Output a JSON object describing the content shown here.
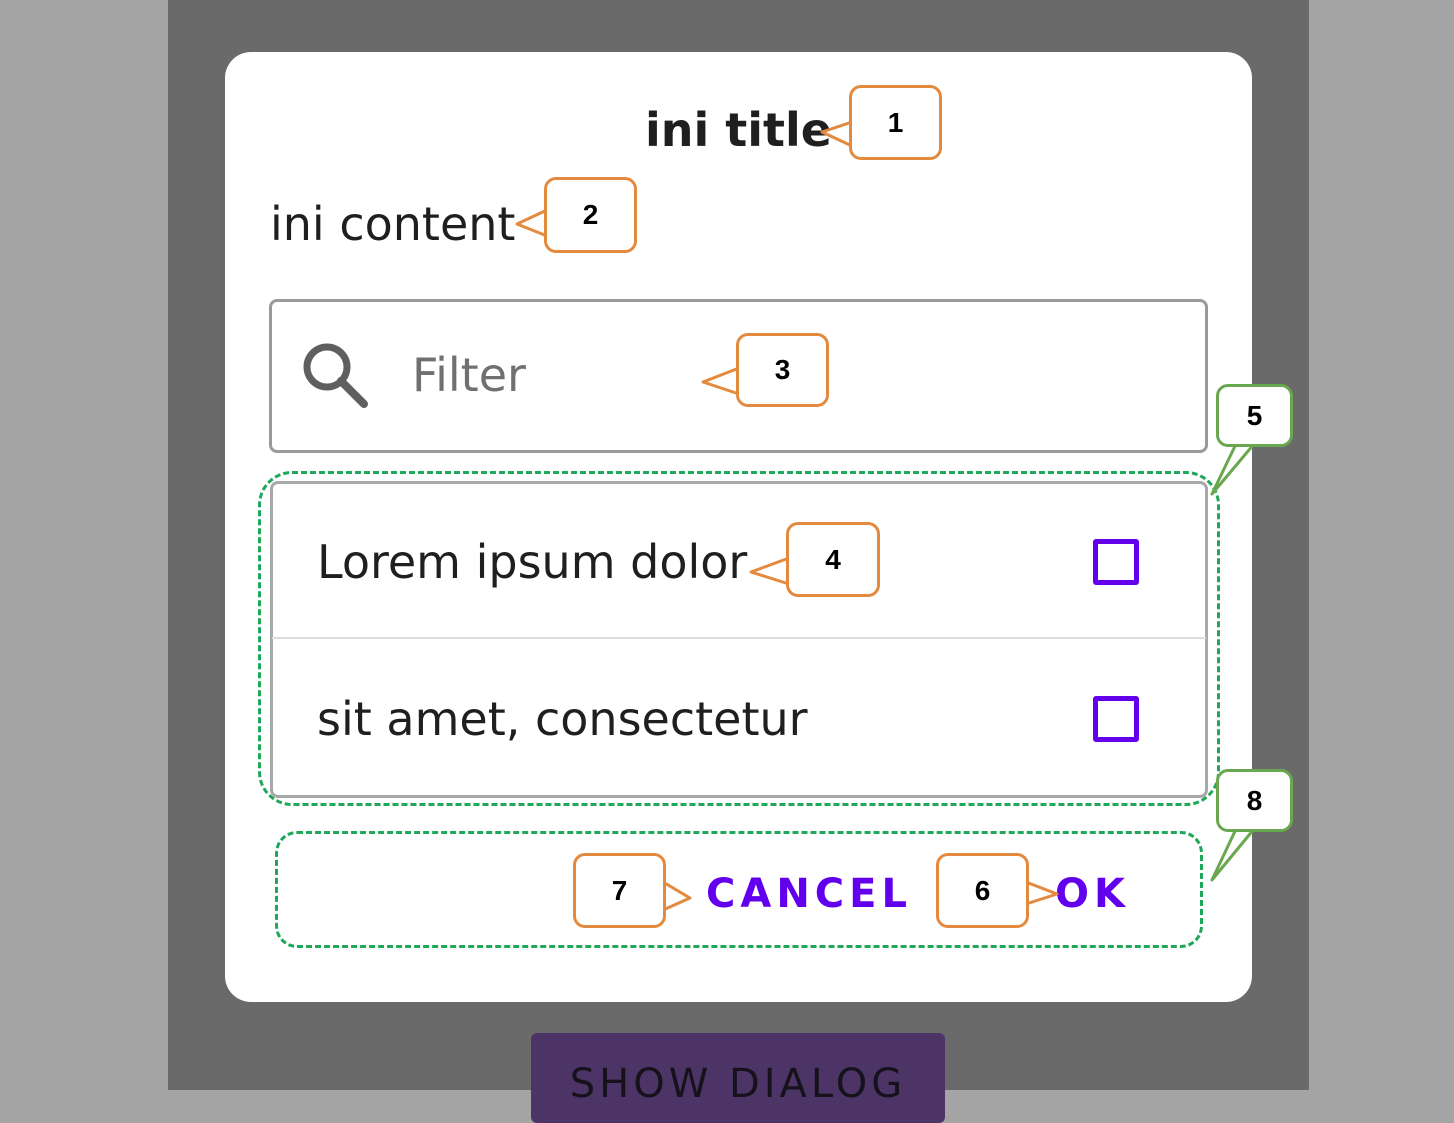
{
  "dialog": {
    "title": "ini title",
    "content": "ini content",
    "filter": {
      "placeholder": "Filter",
      "value": ""
    },
    "items": [
      {
        "label": "Lorem ipsum dolor",
        "checked": false
      },
      {
        "label": "sit amet, consectetur",
        "checked": false
      }
    ],
    "cancel_label": "CANCEL",
    "ok_label": "OK"
  },
  "background_button": {
    "label": "SHOW DIALOG"
  },
  "annotations": {
    "title": "1",
    "content": "2",
    "filter": "3",
    "list_item": "4",
    "list": "5",
    "ok": "6",
    "cancel": "7",
    "buttons": "8"
  },
  "colors": {
    "accent": "#6200ee",
    "scrim": "#6a6a6a",
    "callout_border": "#e38a3e",
    "callout_border_group": "#6aa84f",
    "dashed_group": "#1fa85a"
  }
}
